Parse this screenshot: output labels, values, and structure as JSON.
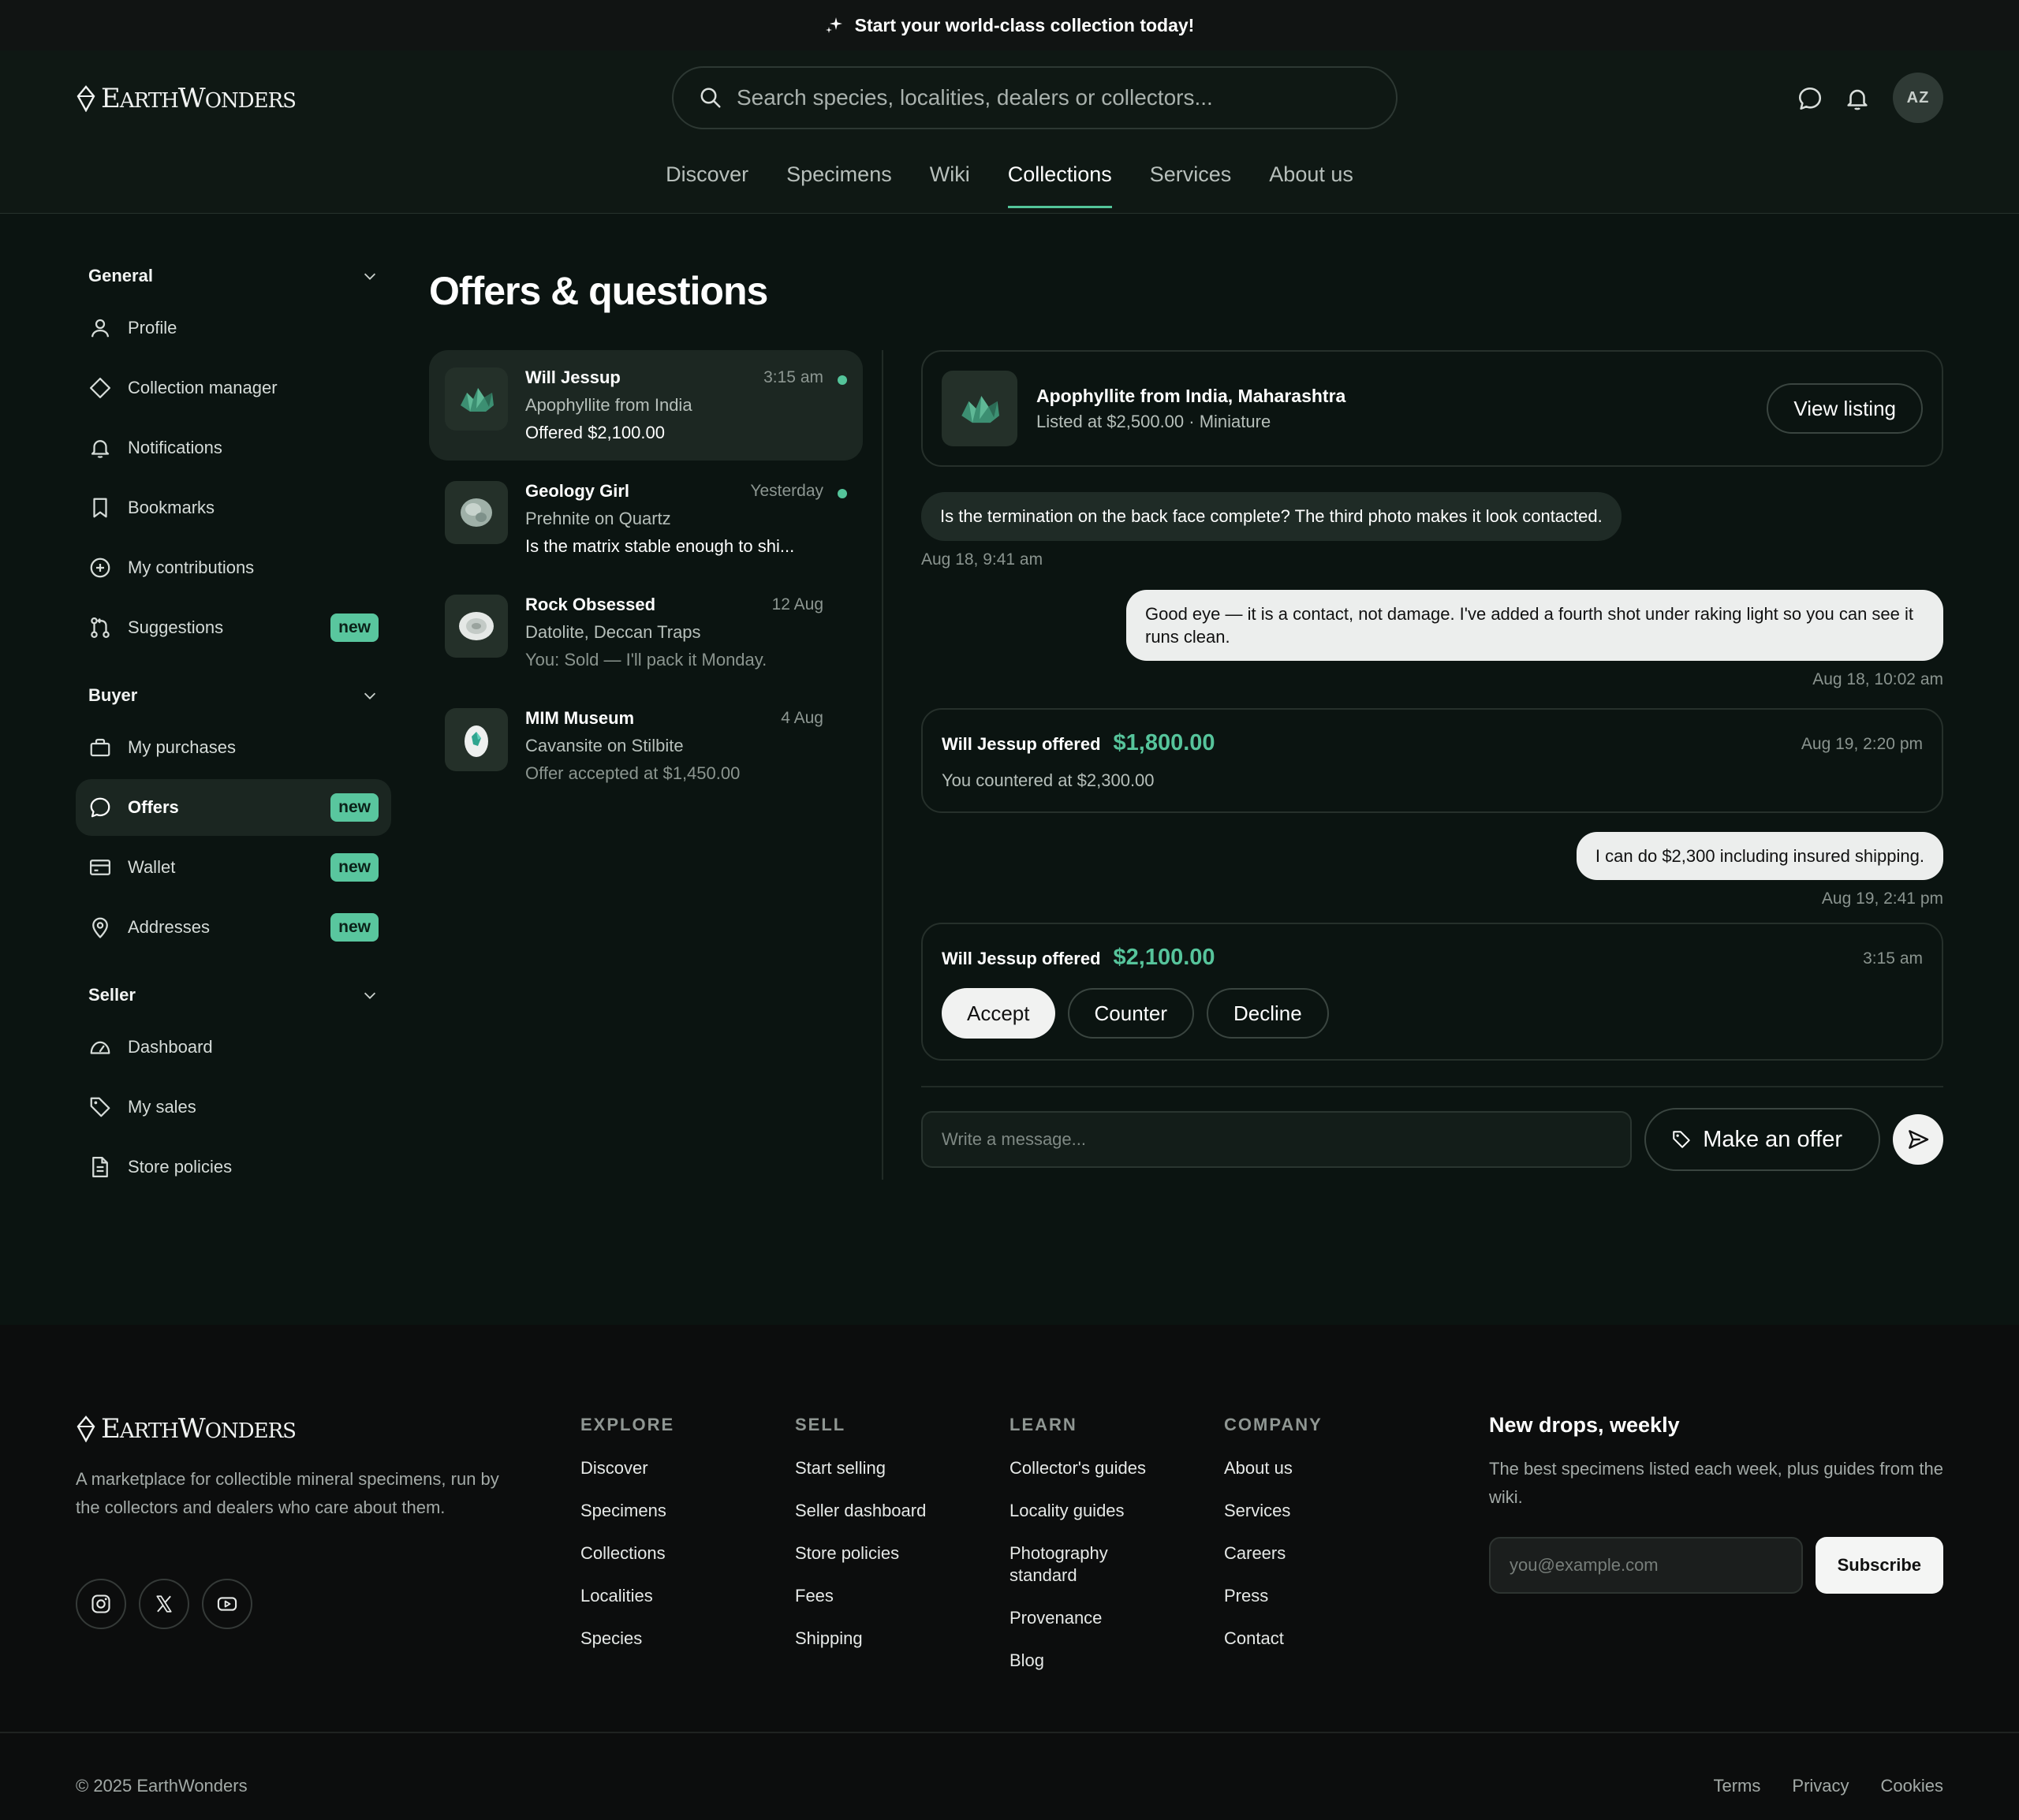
{
  "announcement": {
    "text": "Start your world-class collection today!"
  },
  "brand": {
    "big_e": "E",
    "arth": "ARTH",
    "big_w": "W",
    "onders": "ONDERS"
  },
  "header": {
    "search_placeholder": "Search species, localities, dealers or collectors...",
    "avatar_initials": "AZ",
    "nav": [
      "Discover",
      "Specimens",
      "Wiki",
      "Collections",
      "Services",
      "About us"
    ],
    "active_nav": "Collections"
  },
  "sidebar": {
    "general": {
      "title": "General",
      "items": [
        {
          "label": "Profile",
          "icon": "user-icon"
        },
        {
          "label": "Collection manager",
          "icon": "diamond-icon"
        },
        {
          "label": "Notifications",
          "icon": "bell-icon"
        },
        {
          "label": "Bookmarks",
          "icon": "bookmark-icon"
        },
        {
          "label": "My contributions",
          "icon": "plus-circle-icon"
        },
        {
          "label": "Suggestions",
          "icon": "git-pull-icon",
          "badge": "new"
        }
      ]
    },
    "buyer": {
      "title": "Buyer",
      "items": [
        {
          "label": "My purchases",
          "icon": "bag-icon"
        },
        {
          "label": "Offers",
          "icon": "message-icon",
          "badge": "new",
          "active": true
        },
        {
          "label": "Wallet",
          "icon": "card-icon",
          "badge": "new"
        },
        {
          "label": "Addresses",
          "icon": "pin-icon",
          "badge": "new"
        }
      ]
    },
    "seller": {
      "title": "Seller",
      "items": [
        {
          "label": "Dashboard",
          "icon": "gauge-icon"
        },
        {
          "label": "My sales",
          "icon": "tag-icon"
        },
        {
          "label": "Store policies",
          "icon": "document-icon"
        }
      ]
    }
  },
  "page": {
    "title": "Offers & questions"
  },
  "conversations": [
    {
      "name": "Will Jessup",
      "time": "3:15 am",
      "item": "Apophyllite from India",
      "preview": "Offered $2,100.00",
      "unread": true,
      "active": true
    },
    {
      "name": "Geology Girl",
      "time": "Yesterday",
      "item": "Prehnite on Quartz",
      "preview": "Is the matrix stable enough to shi...",
      "unread": true
    },
    {
      "name": "Rock Obsessed",
      "time": "12 Aug",
      "item": "Datolite, Deccan Traps",
      "preview": "You: Sold — I'll pack it Monday.",
      "unread": false
    },
    {
      "name": "MIM Museum",
      "time": "4 Aug",
      "item": "Cavansite on Stilbite",
      "preview": "Offer accepted at $1,450.00",
      "unread": false
    }
  ],
  "thread": {
    "listing": {
      "title": "Apophyllite from India, Maharashtra",
      "meta": "Listed at $2,500.00 · Miniature",
      "button": "View listing"
    },
    "msg1": {
      "text": "Is the termination on the back face complete? The third photo makes it look contacted.",
      "time": "Aug 18, 9:41 am"
    },
    "msg2": {
      "text": "Good eye — it is a contact, not damage. I've added a fourth shot under raking light so you can see it runs clean.",
      "time": "Aug 18, 10:02 am"
    },
    "offer1": {
      "who": "Will Jessup offered",
      "amount": "$1,800.00",
      "time": "Aug 19, 2:20 pm",
      "counter": "You countered at $2,300.00"
    },
    "msg3": {
      "text": "I can do $2,300 including insured shipping.",
      "time": "Aug 19, 2:41 pm"
    },
    "offer2": {
      "who": "Will Jessup offered",
      "amount": "$2,100.00",
      "time": "3:15 am",
      "accept": "Accept",
      "counter": "Counter",
      "decline": "Decline"
    },
    "composer": {
      "placeholder": "Write a message...",
      "offer_button": "Make an offer"
    }
  },
  "footer": {
    "tagline": "A marketplace for collectible mineral specimens, run by the collectors and dealers who care about them.",
    "columns": [
      {
        "title": "EXPLORE",
        "links": [
          "Discover",
          "Specimens",
          "Collections",
          "Localities",
          "Species"
        ]
      },
      {
        "title": "SELL",
        "links": [
          "Start selling",
          "Seller dashboard",
          "Store policies",
          "Fees",
          "Shipping"
        ]
      },
      {
        "title": "LEARN",
        "links": [
          "Collector's guides",
          "Locality guides",
          "Photography standard",
          "Provenance",
          "Blog"
        ]
      },
      {
        "title": "COMPANY",
        "links": [
          "About us",
          "Services",
          "Careers",
          "Press",
          "Contact"
        ]
      }
    ],
    "newsletter": {
      "title": "New drops, weekly",
      "desc": "The best specimens listed each week, plus guides from the wiki.",
      "placeholder": "you@example.com",
      "button": "Subscribe"
    },
    "copyright": "© 2025 EarthWonders",
    "legal": [
      "Terms",
      "Privacy",
      "Cookies"
    ]
  },
  "colors": {
    "accent": "#56c49b",
    "background": "#0b1411",
    "footer": "#0c0d0d"
  }
}
